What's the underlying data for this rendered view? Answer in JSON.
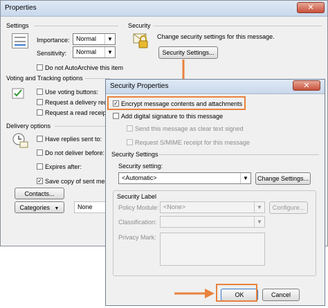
{
  "properties_window": {
    "title": "Properties",
    "close_glyph": "✕",
    "settings": {
      "group_label": "Settings",
      "importance_label": "Importance:",
      "importance_value": "Normal",
      "sensitivity_label": "Sensitivity:",
      "sensitivity_value": "Normal",
      "autoarchive_label": "Do not AutoArchive this item"
    },
    "security": {
      "group_label": "Security",
      "description": "Change security settings for this message.",
      "button_label": "Security Settings..."
    },
    "voting": {
      "group_label": "Voting and Tracking options",
      "use_voting_label": "Use voting buttons:",
      "delivery_receipt_label": "Request a delivery recei",
      "read_receipt_label": "Request a read receipt"
    },
    "delivery": {
      "group_label": "Delivery options",
      "have_replies_label": "Have replies sent to:",
      "do_not_deliver_label": "Do not deliver before:",
      "expires_after_label": "Expires after:",
      "save_copy_label": "Save copy of sent messa",
      "contacts_button": "Contacts...",
      "categories_button": "Categories",
      "categories_value": "None"
    }
  },
  "security_dialog": {
    "title": "Security Properties",
    "close_glyph": "✕",
    "encrypt_label": "Encrypt message contents and attachments",
    "encrypt_checked": true,
    "add_signature_label": "Add digital signature to this message",
    "clear_text_label": "Send this message as clear text signed",
    "smime_receipt_label": "Request S/MIME receipt for this message",
    "security_settings_group": "Security Settings",
    "security_setting_label": "Security setting:",
    "security_setting_value": "<Automatic>",
    "change_settings_button": "Change Settings...",
    "security_label_group": "Security Label",
    "policy_module_label": "Policy Module:",
    "policy_module_value": "<None>",
    "configure_button": "Configure...",
    "classification_label": "Classification:",
    "privacy_mark_label": "Privacy Mark:",
    "ok_button": "OK",
    "cancel_button": "Cancel"
  },
  "colors": {
    "highlight": "#e8823c",
    "titlebar": "#c9d8ec",
    "dialog_bg": "#f0f0f0"
  }
}
